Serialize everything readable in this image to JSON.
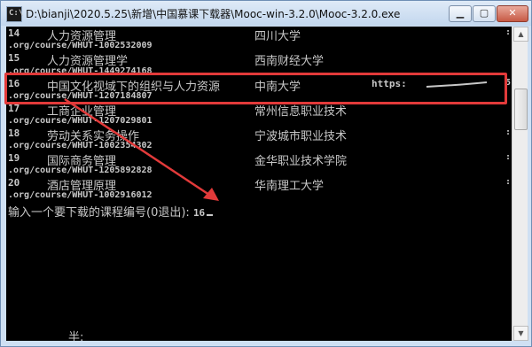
{
  "window": {
    "title": "D:\\bianji\\2020.5.25\\新增\\中国慕课下载器\\Mooc-win-3.2.0\\Mooc-3.2.0.exe",
    "icon_label": "C:\\",
    "minimize_icon": "minimize-icon",
    "maximize_icon": "maximize-icon",
    "close_icon": "close-icon"
  },
  "console": {
    "rows": [
      {
        "num": "14",
        "course": "人力资源管理",
        "school": "四川大学",
        "url": ".org/course/WHUT-1002532009",
        "edge": ":"
      },
      {
        "num": "15",
        "course": "人力资源管理学",
        "school": "西南财经大学",
        "url": ".org/course/WHUT-1449274168",
        "edge": ""
      },
      {
        "num": "16",
        "course": "中国文化视域下的组织与人力资源",
        "school": "中南大学",
        "https": "https:",
        "edge": "5",
        "url": ".org/course/WHUT-1207184807"
      },
      {
        "num": "17",
        "course": "工商企业管理",
        "school": "常州信息职业技术",
        "url": ".org/course/WHUT-1207029801",
        "edge": ""
      },
      {
        "num": "18",
        "course": "劳动关系实务操作",
        "school": "宁波城市职业技术",
        "url": ".org/course/WHUT-1002354302",
        "edge": ":"
      },
      {
        "num": "19",
        "course": "国际商务管理",
        "school": "金华职业技术学院",
        "url": ".org/course/WHUT-1205892828",
        "edge": ":"
      },
      {
        "num": "20",
        "course": "酒店管理原理",
        "school": "华南理工大学",
        "url": ".org/course/WHUT-1002916012",
        "edge": ":"
      }
    ],
    "prompt_text": "输入一个要下载的课程编号(0退出): ",
    "prompt_value": "16",
    "bottom_text": "半:"
  },
  "colors": {
    "console_bg": "#000000",
    "console_text": "#c8c8c8",
    "highlight": "#e23a3a"
  }
}
